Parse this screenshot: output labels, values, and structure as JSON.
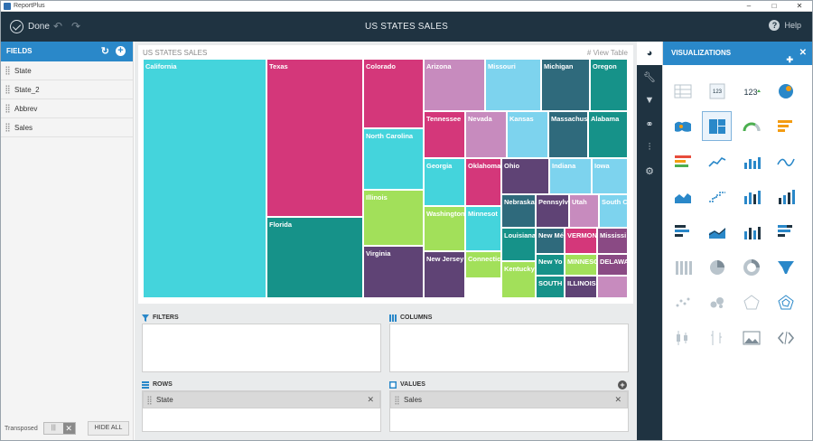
{
  "window": {
    "app_title": "ReportPlus"
  },
  "toolbar": {
    "done_label": "Done",
    "title": "US STATES SALES",
    "help_label": "Help"
  },
  "fields": {
    "header": "FIELDS",
    "items": [
      "State",
      "State_2",
      "Abbrev",
      "Sales"
    ],
    "transposed_label": "Transposed",
    "hide_all_label": "HIDE ALL"
  },
  "chart": {
    "title": "US STATES SALES",
    "view_table_label": "View Table"
  },
  "chart_data": {
    "type": "treemap",
    "title": "US STATES SALES",
    "labels": [
      "California",
      "Texas",
      "Colorado",
      "Arizona",
      "Missouri",
      "Michigan",
      "Oregon",
      "Tennessee",
      "Nevada",
      "Kansas",
      "Massachus",
      "Alabama",
      "North Carolina",
      "Georgia",
      "Oklahoma",
      "Ohio",
      "Indiana",
      "Iowa",
      "Illinois",
      "Nebraska",
      "Pennsylv",
      "Utah",
      "South C",
      "Florida",
      "Washington",
      "Minnesot",
      "Louisiana",
      "New Mé",
      "VERMON",
      "Mississi",
      "Virginia",
      "New Jersey",
      "Connectic",
      "Kentucky",
      "New Yo",
      "MINNESO",
      "DELAWA",
      "SOUTH C",
      "ILLINOIS"
    ]
  },
  "drop_zones": {
    "filters": "FILTERS",
    "columns": "COLUMNS",
    "rows": "ROWS",
    "values": "VALUES",
    "rows_item": "State",
    "values_item": "Sales"
  },
  "visualizations": {
    "header": "VISUALIZATIONS",
    "selected": "treemap"
  },
  "colors": {
    "toolbar_bg": "#1f3341",
    "accent_blue": "#2a88c9",
    "treemap_cyan": "#44d4dc",
    "treemap_magenta": "#d4377a",
    "treemap_teal": "#169289",
    "treemap_purple": "#5f4375"
  }
}
